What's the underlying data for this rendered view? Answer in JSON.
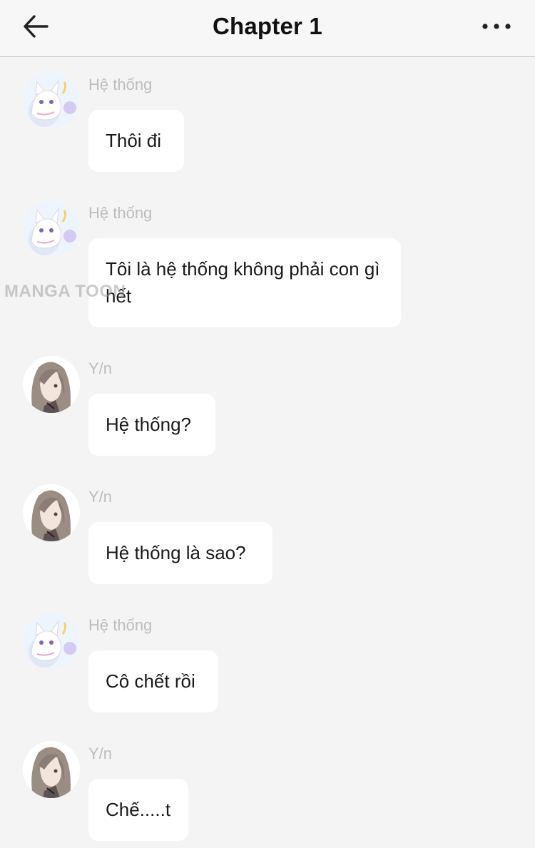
{
  "header": {
    "title": "Chapter 1",
    "back_icon": "arrow-left-icon",
    "more_icon": "more-horizontal-icon"
  },
  "watermark": "MANGA TOON",
  "messages": [
    {
      "sender": "Hệ thống",
      "avatar": "cat-avatar",
      "text": "Thôi đi"
    },
    {
      "sender": "Hệ thống",
      "avatar": "cat-avatar",
      "text": "Tôi là hệ thống không phải con gì hết"
    },
    {
      "sender": "Y/n",
      "avatar": "girl-avatar",
      "text": "Hệ thống?"
    },
    {
      "sender": "Y/n",
      "avatar": "girl-avatar",
      "text": "Hệ thống là sao?"
    },
    {
      "sender": "Hệ thống",
      "avatar": "cat-avatar",
      "text": "Cô chết rồi"
    },
    {
      "sender": "Y/n",
      "avatar": "girl-avatar",
      "text": "Chế.....t"
    }
  ]
}
